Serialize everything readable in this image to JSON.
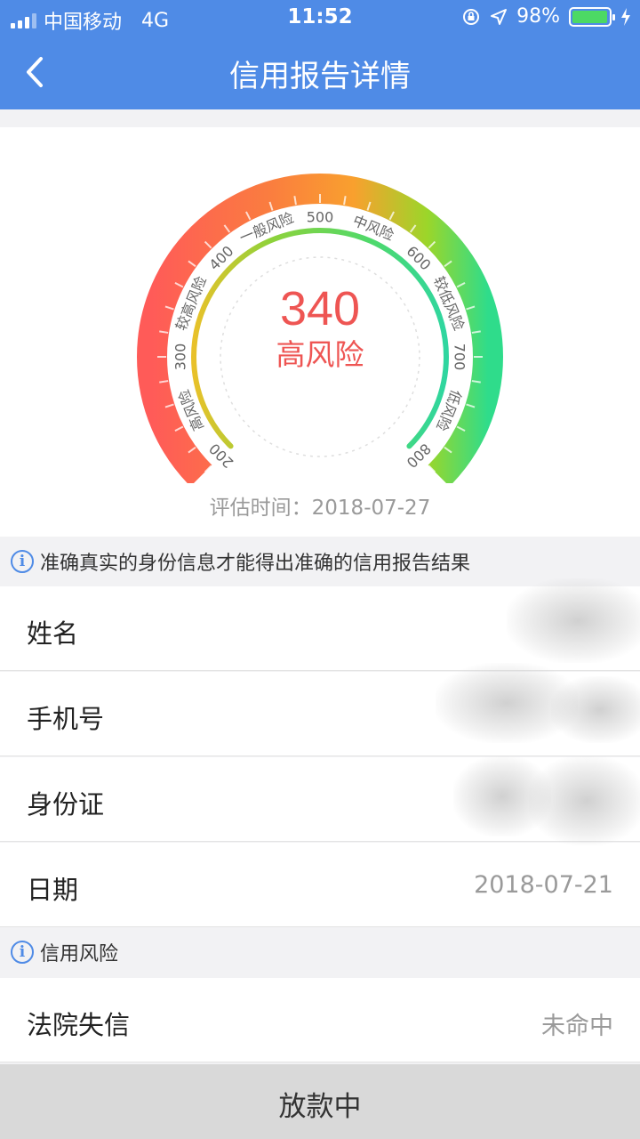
{
  "status_bar": {
    "carrier": "中国移动",
    "network": "4G",
    "time": "11:52",
    "battery": "98%",
    "battery_level": 0.98
  },
  "nav": {
    "title": "信用报告详情"
  },
  "gauge": {
    "score": "340",
    "level_label": "高风险",
    "score_value": 340,
    "range": [
      200,
      800
    ],
    "tick_labels": [
      "200",
      "300",
      "400",
      "500",
      "600",
      "700",
      "800"
    ],
    "risk_labels": [
      "高风险",
      "较高风险",
      "一般风险",
      "中风险",
      "较低风险",
      "低风险"
    ],
    "evaluation_label": "评估时间：",
    "evaluation_date": "2018-07-27",
    "colors": {
      "high": "#ff5b58",
      "mid": "#f9a02e",
      "low": "#2fdc8b",
      "score": "#ee5553"
    }
  },
  "notice_identity": "准确真实的身份信息才能得出准确的信用报告结果",
  "identity_rows": [
    {
      "label": "姓名",
      "value": ""
    },
    {
      "label": "手机号",
      "value": ""
    },
    {
      "label": "身份证",
      "value": ""
    },
    {
      "label": "日期",
      "value": "2018-07-21"
    }
  ],
  "notice_risk": "信用风险",
  "risk_rows": [
    {
      "label": "法院失信",
      "value": "未命中"
    }
  ],
  "footer_button": "放款中"
}
